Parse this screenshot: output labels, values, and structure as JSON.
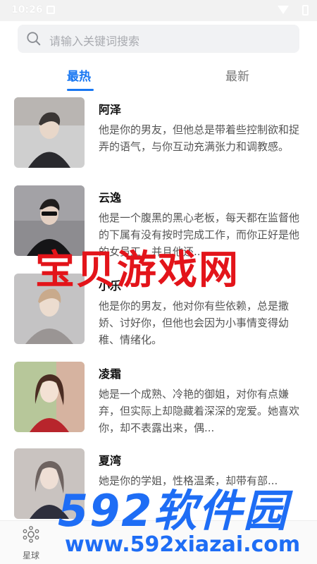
{
  "status_bar": {
    "time": "10:26"
  },
  "search": {
    "placeholder": "请输入关键词搜索"
  },
  "tabs": [
    {
      "label": "最热",
      "active": true
    },
    {
      "label": "最新",
      "active": false
    }
  ],
  "characters": [
    {
      "name": "阿泽",
      "description": "他是你的男友，但他总是带着些控制欲和捉弄的语气，与你互动充满张力和调教感。"
    },
    {
      "name": "云逸",
      "description": "他是一个腹黑的黑心老板，每天都在监督他的下属有没有按时完成工作，而你正好是他的女员工，并且他还..."
    },
    {
      "name": "小乐",
      "description": "他是你的男友，他对你有些依赖，总是撒娇、讨好你，但他也会因为小事情变得幼稚、情绪化。"
    },
    {
      "name": "凌霜",
      "description": "她是一个成熟、冷艳的御姐，对你有点嫌弃，但实际上却隐藏着深深的宠爱。她喜欢你，却不表露出来，偶..."
    },
    {
      "name": "夏湾",
      "description": "她是你的学姐，性格温柔，却带有部..."
    }
  ],
  "bottom_nav": {
    "label": "星球",
    "icon": "planet-icon"
  },
  "watermark": {
    "title": "宝贝游戏网",
    "brand": "592软件园",
    "url": "www.592xiazai.com"
  },
  "colors": {
    "accent": "#1877f2",
    "watermark_red": "#e3141a",
    "watermark_blue": "#1e6df5"
  }
}
